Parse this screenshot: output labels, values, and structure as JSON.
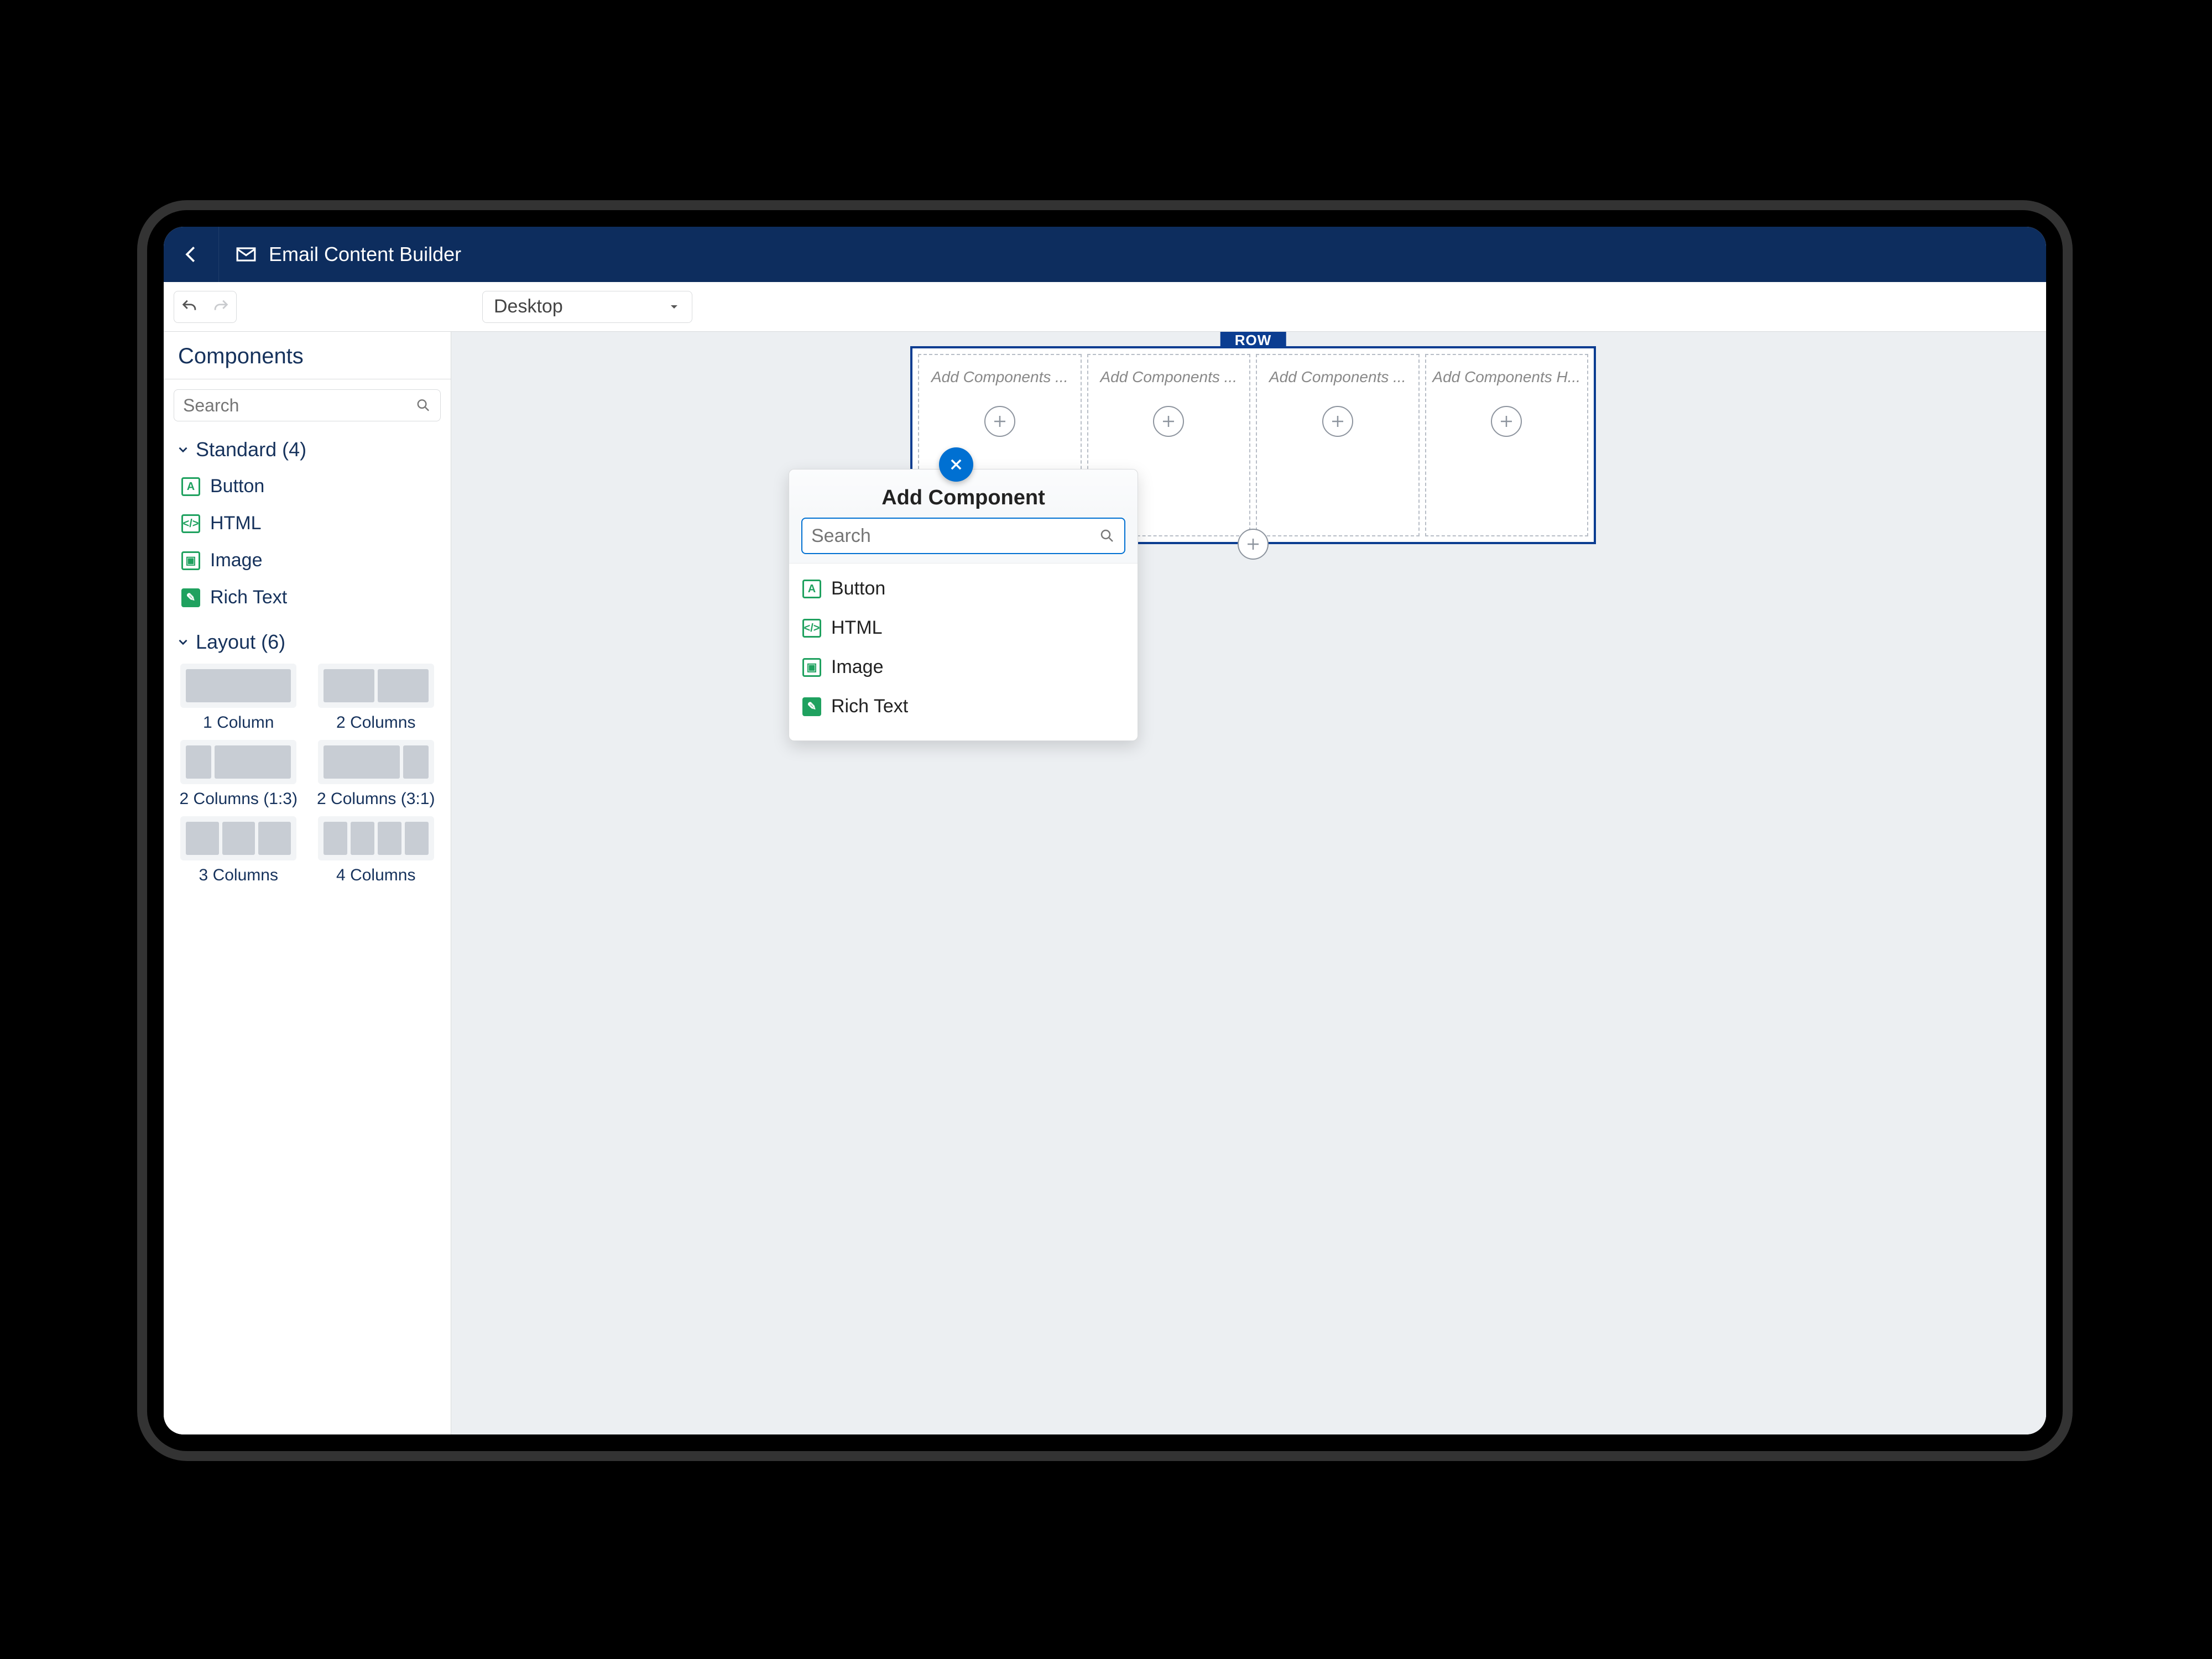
{
  "header": {
    "title": "Email Content Builder"
  },
  "toolbar": {
    "device": "Desktop"
  },
  "sidebar": {
    "title": "Components",
    "search_placeholder": "Search",
    "standard_header": "Standard (4)",
    "standard_items": [
      {
        "label": "Button",
        "icon": "A"
      },
      {
        "label": "HTML",
        "icon": "</>"
      },
      {
        "label": "Image",
        "icon": "▣"
      },
      {
        "label": "Rich Text",
        "icon": "✎"
      }
    ],
    "layout_header": "Layout (6)",
    "layouts": [
      {
        "label": "1 Column",
        "cols": [
          1
        ]
      },
      {
        "label": "2 Columns",
        "cols": [
          1,
          1
        ]
      },
      {
        "label": "2 Columns (1:3)",
        "cols": [
          1,
          3
        ]
      },
      {
        "label": "2 Columns (3:1)",
        "cols": [
          3,
          1
        ]
      },
      {
        "label": "3 Columns",
        "cols": [
          1,
          1,
          1
        ]
      },
      {
        "label": "4 Columns",
        "cols": [
          1,
          1,
          1,
          1
        ]
      }
    ]
  },
  "canvas": {
    "row_label": "ROW",
    "slots": [
      {
        "text": "Add Components ..."
      },
      {
        "text": "Add Components ..."
      },
      {
        "text": "Add Components ..."
      },
      {
        "text": "Add Components H..."
      }
    ]
  },
  "popover": {
    "title": "Add Component",
    "search_placeholder": "Search",
    "items": [
      {
        "label": "Button",
        "icon": "A"
      },
      {
        "label": "HTML",
        "icon": "</>"
      },
      {
        "label": "Image",
        "icon": "▣"
      },
      {
        "label": "Rich Text",
        "icon": "✎"
      }
    ]
  }
}
